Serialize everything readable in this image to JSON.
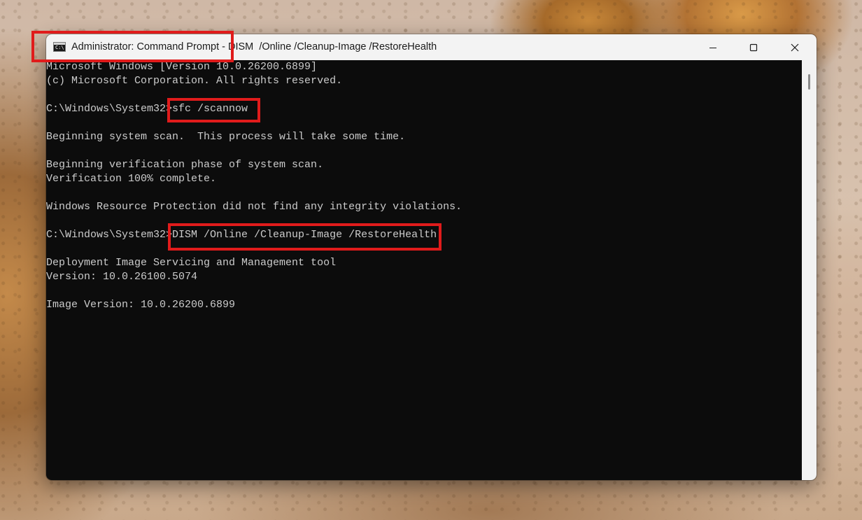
{
  "window": {
    "title": "Administrator: Command Prompt - DISM  /Online /Cleanup-Image /RestoreHealth",
    "icon_text": "C:\\",
    "icons": {
      "app": "command-prompt-icon",
      "minimize": "minimize-icon",
      "maximize": "maximize-icon",
      "close": "close-icon"
    }
  },
  "console": {
    "lines": [
      "Microsoft Windows [Version 10.0.26200.6899]",
      "(c) Microsoft Corporation. All rights reserved.",
      "",
      "C:\\Windows\\System32>sfc /scannow",
      "",
      "Beginning system scan.  This process will take some time.",
      "",
      "Beginning verification phase of system scan.",
      "Verification 100% complete.",
      "",
      "Windows Resource Protection did not find any integrity violations.",
      "",
      "C:\\Windows\\System32>DISM /Online /Cleanup-Image /RestoreHealth",
      "",
      "Deployment Image Servicing and Management tool",
      "Version: 10.0.26100.5074",
      "",
      "Image Version: 10.0.26200.6899"
    ],
    "text_color": "#cccccc",
    "background": "#0c0c0c"
  },
  "annotations": {
    "color": "#e01b1b"
  }
}
